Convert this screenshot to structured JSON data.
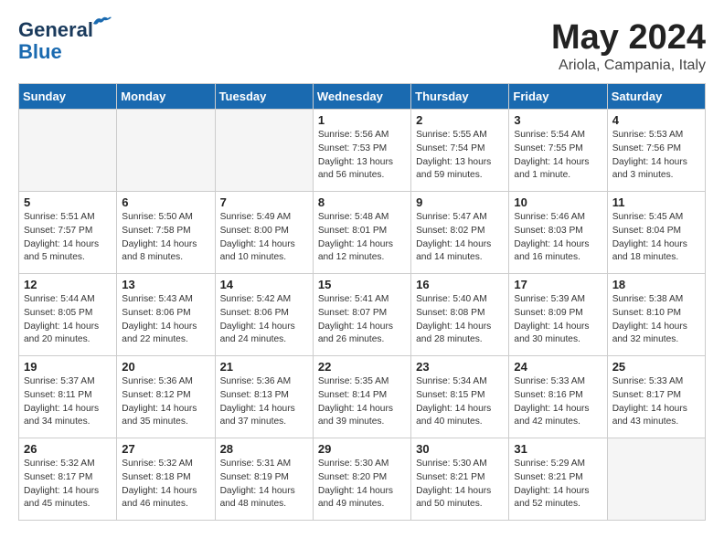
{
  "header": {
    "logo_line1": "General",
    "logo_line2": "Blue",
    "month": "May 2024",
    "location": "Ariola, Campania, Italy"
  },
  "days_of_week": [
    "Sunday",
    "Monday",
    "Tuesday",
    "Wednesday",
    "Thursday",
    "Friday",
    "Saturday"
  ],
  "weeks": [
    [
      {
        "num": "",
        "info": ""
      },
      {
        "num": "",
        "info": ""
      },
      {
        "num": "",
        "info": ""
      },
      {
        "num": "1",
        "info": "Sunrise: 5:56 AM\nSunset: 7:53 PM\nDaylight: 13 hours\nand 56 minutes."
      },
      {
        "num": "2",
        "info": "Sunrise: 5:55 AM\nSunset: 7:54 PM\nDaylight: 13 hours\nand 59 minutes."
      },
      {
        "num": "3",
        "info": "Sunrise: 5:54 AM\nSunset: 7:55 PM\nDaylight: 14 hours\nand 1 minute."
      },
      {
        "num": "4",
        "info": "Sunrise: 5:53 AM\nSunset: 7:56 PM\nDaylight: 14 hours\nand 3 minutes."
      }
    ],
    [
      {
        "num": "5",
        "info": "Sunrise: 5:51 AM\nSunset: 7:57 PM\nDaylight: 14 hours\nand 5 minutes."
      },
      {
        "num": "6",
        "info": "Sunrise: 5:50 AM\nSunset: 7:58 PM\nDaylight: 14 hours\nand 8 minutes."
      },
      {
        "num": "7",
        "info": "Sunrise: 5:49 AM\nSunset: 8:00 PM\nDaylight: 14 hours\nand 10 minutes."
      },
      {
        "num": "8",
        "info": "Sunrise: 5:48 AM\nSunset: 8:01 PM\nDaylight: 14 hours\nand 12 minutes."
      },
      {
        "num": "9",
        "info": "Sunrise: 5:47 AM\nSunset: 8:02 PM\nDaylight: 14 hours\nand 14 minutes."
      },
      {
        "num": "10",
        "info": "Sunrise: 5:46 AM\nSunset: 8:03 PM\nDaylight: 14 hours\nand 16 minutes."
      },
      {
        "num": "11",
        "info": "Sunrise: 5:45 AM\nSunset: 8:04 PM\nDaylight: 14 hours\nand 18 minutes."
      }
    ],
    [
      {
        "num": "12",
        "info": "Sunrise: 5:44 AM\nSunset: 8:05 PM\nDaylight: 14 hours\nand 20 minutes."
      },
      {
        "num": "13",
        "info": "Sunrise: 5:43 AM\nSunset: 8:06 PM\nDaylight: 14 hours\nand 22 minutes."
      },
      {
        "num": "14",
        "info": "Sunrise: 5:42 AM\nSunset: 8:06 PM\nDaylight: 14 hours\nand 24 minutes."
      },
      {
        "num": "15",
        "info": "Sunrise: 5:41 AM\nSunset: 8:07 PM\nDaylight: 14 hours\nand 26 minutes."
      },
      {
        "num": "16",
        "info": "Sunrise: 5:40 AM\nSunset: 8:08 PM\nDaylight: 14 hours\nand 28 minutes."
      },
      {
        "num": "17",
        "info": "Sunrise: 5:39 AM\nSunset: 8:09 PM\nDaylight: 14 hours\nand 30 minutes."
      },
      {
        "num": "18",
        "info": "Sunrise: 5:38 AM\nSunset: 8:10 PM\nDaylight: 14 hours\nand 32 minutes."
      }
    ],
    [
      {
        "num": "19",
        "info": "Sunrise: 5:37 AM\nSunset: 8:11 PM\nDaylight: 14 hours\nand 34 minutes."
      },
      {
        "num": "20",
        "info": "Sunrise: 5:36 AM\nSunset: 8:12 PM\nDaylight: 14 hours\nand 35 minutes."
      },
      {
        "num": "21",
        "info": "Sunrise: 5:36 AM\nSunset: 8:13 PM\nDaylight: 14 hours\nand 37 minutes."
      },
      {
        "num": "22",
        "info": "Sunrise: 5:35 AM\nSunset: 8:14 PM\nDaylight: 14 hours\nand 39 minutes."
      },
      {
        "num": "23",
        "info": "Sunrise: 5:34 AM\nSunset: 8:15 PM\nDaylight: 14 hours\nand 40 minutes."
      },
      {
        "num": "24",
        "info": "Sunrise: 5:33 AM\nSunset: 8:16 PM\nDaylight: 14 hours\nand 42 minutes."
      },
      {
        "num": "25",
        "info": "Sunrise: 5:33 AM\nSunset: 8:17 PM\nDaylight: 14 hours\nand 43 minutes."
      }
    ],
    [
      {
        "num": "26",
        "info": "Sunrise: 5:32 AM\nSunset: 8:17 PM\nDaylight: 14 hours\nand 45 minutes."
      },
      {
        "num": "27",
        "info": "Sunrise: 5:32 AM\nSunset: 8:18 PM\nDaylight: 14 hours\nand 46 minutes."
      },
      {
        "num": "28",
        "info": "Sunrise: 5:31 AM\nSunset: 8:19 PM\nDaylight: 14 hours\nand 48 minutes."
      },
      {
        "num": "29",
        "info": "Sunrise: 5:30 AM\nSunset: 8:20 PM\nDaylight: 14 hours\nand 49 minutes."
      },
      {
        "num": "30",
        "info": "Sunrise: 5:30 AM\nSunset: 8:21 PM\nDaylight: 14 hours\nand 50 minutes."
      },
      {
        "num": "31",
        "info": "Sunrise: 5:29 AM\nSunset: 8:21 PM\nDaylight: 14 hours\nand 52 minutes."
      },
      {
        "num": "",
        "info": ""
      }
    ]
  ]
}
